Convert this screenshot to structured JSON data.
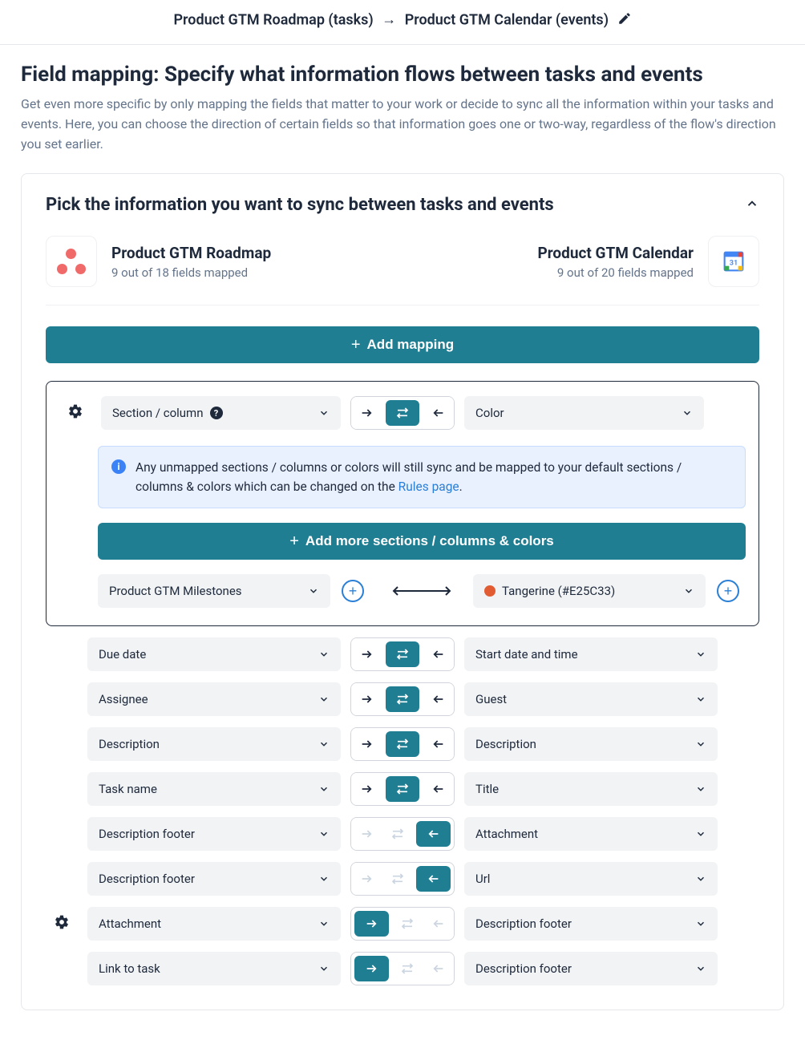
{
  "breadcrumb": {
    "left": "Product GTM Roadmap (tasks)",
    "right": "Product GTM Calendar (events)"
  },
  "page": {
    "title": "Field mapping: Specify what information flows between tasks and events",
    "description": "Get even more specific by only mapping the fields that matter to your work or decide to sync all the information within your tasks and events. Here, you can choose the direction of certain fields so that information goes one or two-way, regardless of the flow's direction you set earlier."
  },
  "card": {
    "title": "Pick the information you want to sync between tasks and events",
    "source_left": {
      "name": "Product GTM Roadmap",
      "sub": "9 out of 18 fields mapped"
    },
    "source_right": {
      "name": "Product GTM Calendar",
      "sub": "9 out of 20 fields mapped"
    },
    "add_mapping": "Add mapping",
    "section_left_label": "Section / column",
    "section_right_label": "Color",
    "info_text_a": "Any unmapped sections / columns or colors will still sync and be mapped to your default sections / columns & colors which can be changed on the ",
    "info_link": "Rules page",
    "info_text_b": ".",
    "add_more": "Add more sections / columns & colors",
    "sub_left": "Product GTM Milestones",
    "sub_right": "Tangerine (#E25C33)",
    "sub_right_color": "#E25C33",
    "rows": [
      {
        "left": "Due date",
        "right": "Start date and time",
        "dir": "both",
        "gear": false
      },
      {
        "left": "Assignee",
        "right": "Guest",
        "dir": "both",
        "gear": false
      },
      {
        "left": "Description",
        "right": "Description",
        "dir": "both",
        "gear": false
      },
      {
        "left": "Task name",
        "right": "Title",
        "dir": "both",
        "gear": false
      },
      {
        "left": "Description footer",
        "right": "Attachment",
        "dir": "left",
        "gear": false
      },
      {
        "left": "Description footer",
        "right": "Url",
        "dir": "left",
        "gear": false
      },
      {
        "left": "Attachment",
        "right": "Description footer",
        "dir": "right",
        "gear": true
      },
      {
        "left": "Link to task",
        "right": "Description footer",
        "dir": "right",
        "gear": false
      }
    ]
  }
}
